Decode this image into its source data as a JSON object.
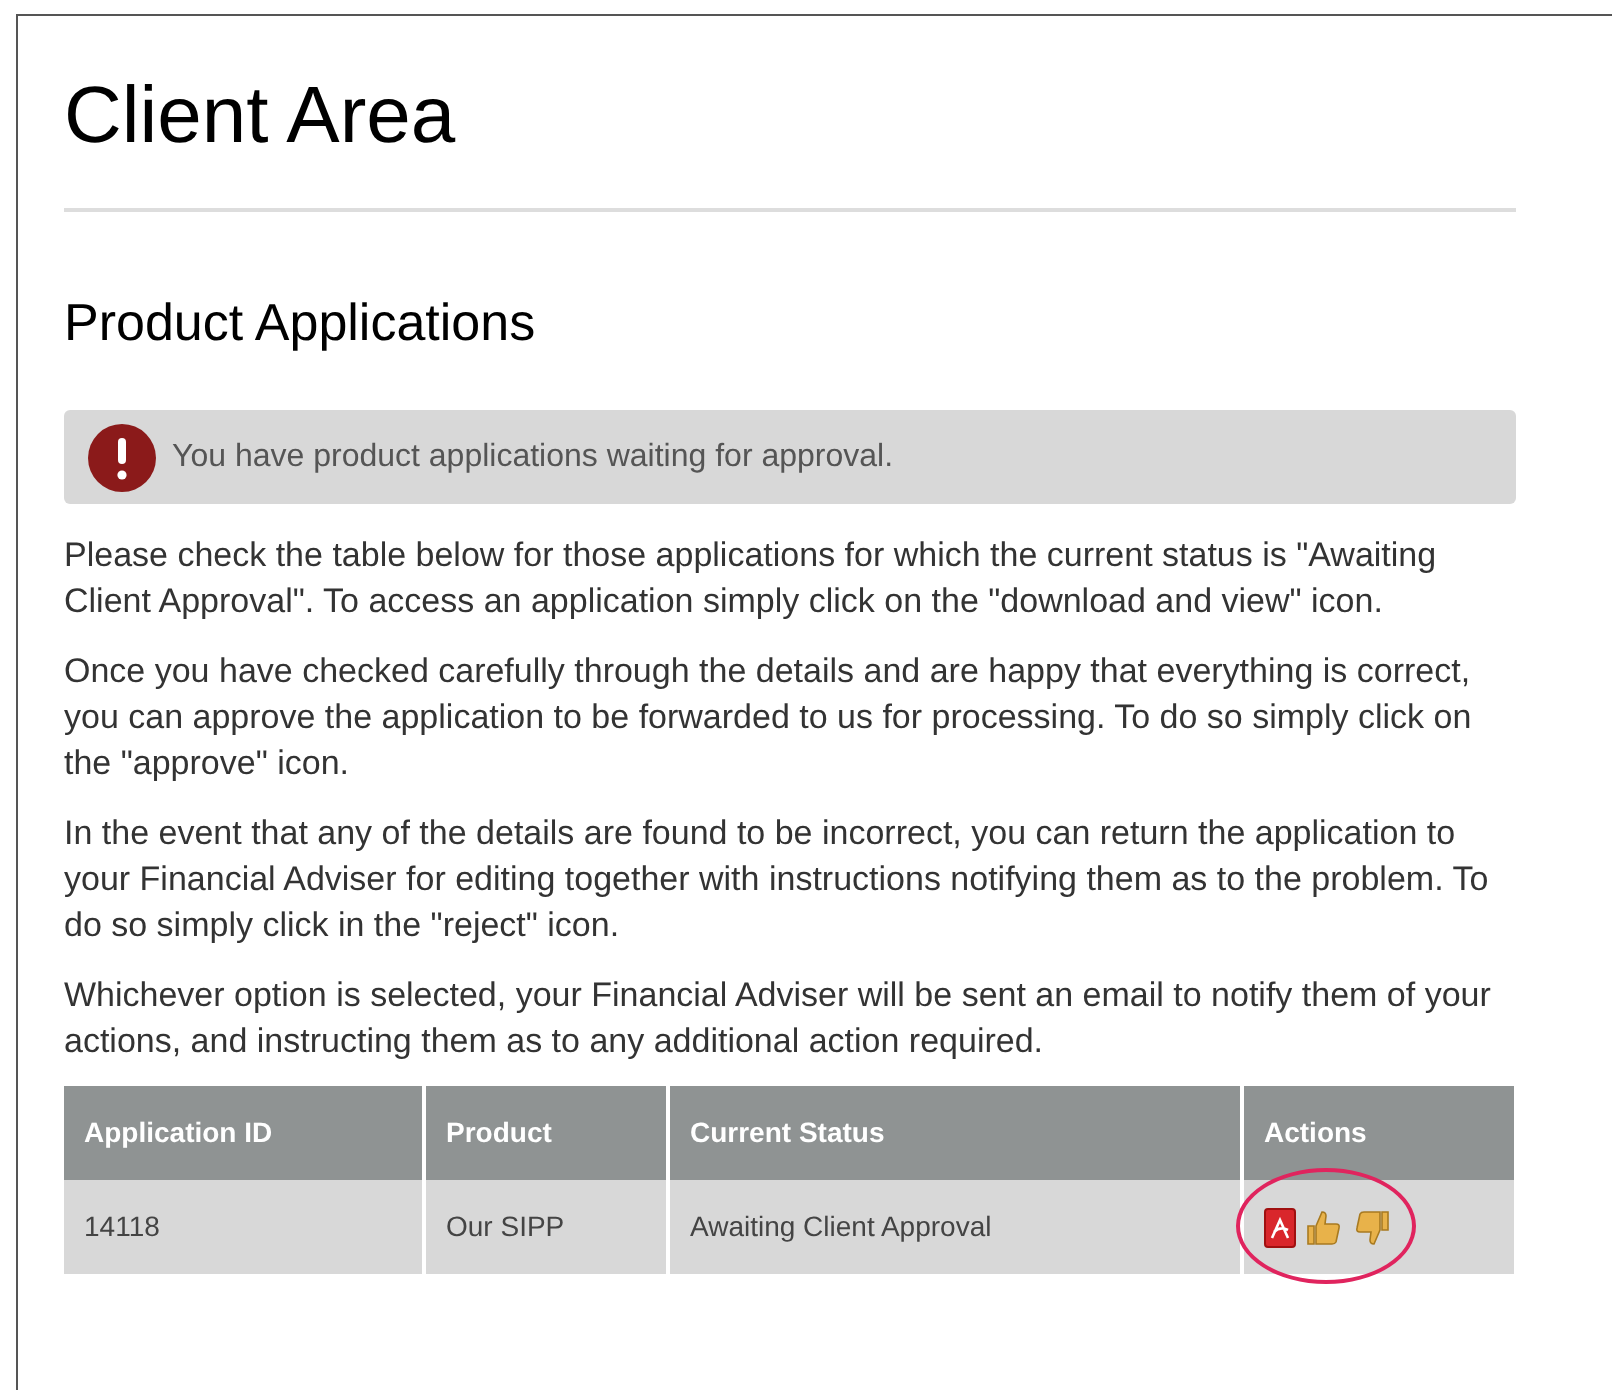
{
  "title": "Client Area",
  "section_title": "Product Applications",
  "alert": {
    "text": "You have product applications waiting for approval."
  },
  "paragraphs": [
    "Please check the table below for those applications for which the current status is \"Awaiting Client Approval\". To access an application simply click on the \"download and view\" icon.",
    "Once you have checked carefully through the details and are happy that everything is correct, you can approve the application to be forwarded to us for processing. To do so simply click on the \"approve\" icon.",
    "In the event that any of the details are found to be incorrect, you can return the application to your Financial Adviser for editing together with instructions notifying them as to the problem. To do so simply click in the \"reject\" icon.",
    "Whichever option is selected, your Financial Adviser will be sent an email to notify them of your actions, and instructing them as to any additional action required."
  ],
  "table": {
    "columns": [
      "Application ID",
      "Product",
      "Current Status",
      "Actions"
    ],
    "rows": [
      {
        "cells": [
          "14118",
          "Our SIPP",
          "Awaiting Client Approval"
        ],
        "actions": [
          {
            "kind": "pdf"
          },
          {
            "kind": "approve"
          },
          {
            "kind": "reject"
          }
        ],
        "highlighted": true
      }
    ]
  }
}
